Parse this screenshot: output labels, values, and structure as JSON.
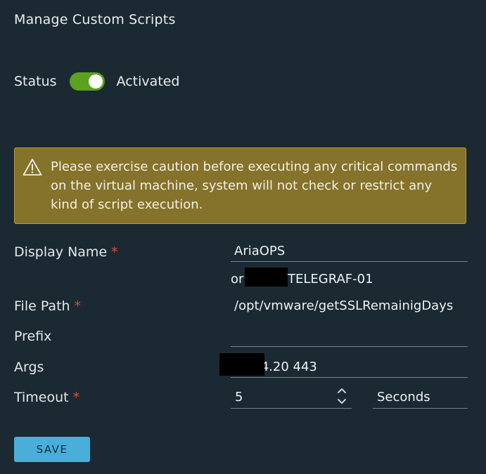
{
  "dialog": {
    "title": "Manage Custom Scripts"
  },
  "status": {
    "label": "Status",
    "toggle_on": true,
    "value_text": "Activated",
    "toggle_color": "#5aa220"
  },
  "alert": {
    "icon": "warning-triangle-icon",
    "message": "Please exercise caution before executing any critical commands on the virtual machine, system will not check or restrict any kind of script execution.",
    "background": "#85722b"
  },
  "form": {
    "required_marker": "*",
    "display_name": {
      "label": "Display Name",
      "required": true,
      "value": "AriaOPS",
      "continuation_prefix": "or",
      "continuation_suffix": "TELEGRAF-01"
    },
    "file_path": {
      "label": "File Path",
      "required": true,
      "value": "/opt/vmware/getSSLRemainigDays"
    },
    "prefix": {
      "label": "Prefix",
      "required": false,
      "value": ""
    },
    "args": {
      "label": "Args",
      "required": false,
      "value_visible": ".4.20 443"
    },
    "timeout": {
      "label": "Timeout",
      "required": true,
      "value": "5",
      "unit": "Seconds"
    }
  },
  "actions": {
    "save_label": "SAVE",
    "save_color": "#49afd9"
  }
}
